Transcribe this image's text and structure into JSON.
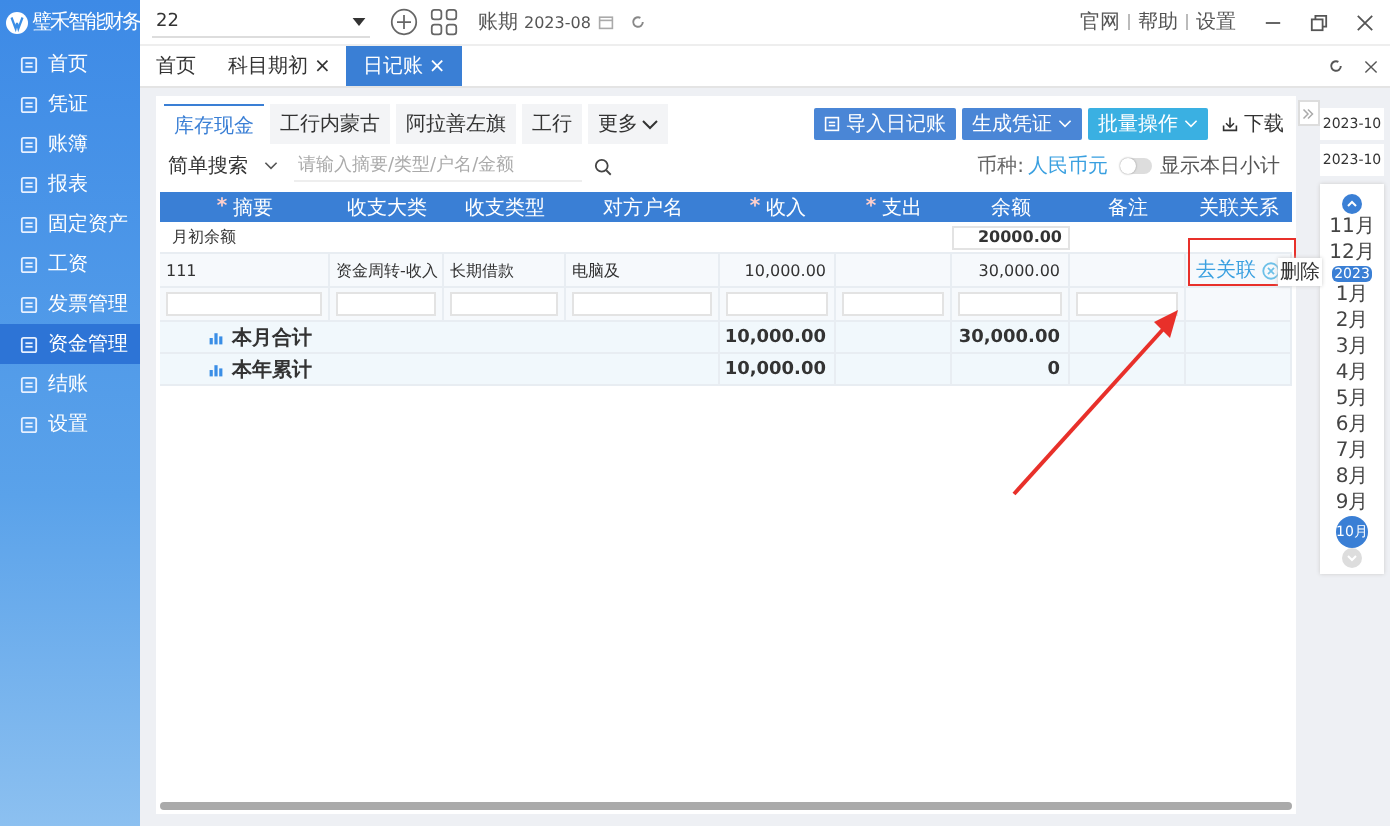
{
  "app": {
    "logo": "璧禾智能财务"
  },
  "sidebar": {
    "items": [
      {
        "label": "首页",
        "selected": false
      },
      {
        "label": "凭证",
        "selected": false
      },
      {
        "label": "账簿",
        "selected": false
      },
      {
        "label": "报表",
        "selected": false
      },
      {
        "label": "固定资产",
        "selected": false
      },
      {
        "label": "工资",
        "selected": false
      },
      {
        "label": "发票管理",
        "selected": false
      },
      {
        "label": "资金管理",
        "selected": true
      },
      {
        "label": "结账",
        "selected": false
      },
      {
        "label": "设置",
        "selected": false
      }
    ]
  },
  "top_bar": {
    "account": "22",
    "period_label": "账期",
    "period": "2023-08",
    "links": [
      "官网",
      "帮助",
      "设置"
    ]
  },
  "tabs": [
    {
      "label": "首页",
      "selected": false
    },
    {
      "label": "科目期初",
      "close_label": "×",
      "selected": false
    },
    {
      "label": "日记账",
      "close_label": "×",
      "selected": true
    }
  ],
  "account_tabs": [
    {
      "label": "库存现金",
      "kind": "tab",
      "selected": true
    },
    {
      "label": "工行内蒙古",
      "kind": "tab",
      "selected": false
    },
    {
      "label": "阿拉善左旗",
      "kind": "tab",
      "selected": false
    },
    {
      "label": "工行",
      "kind": "tab",
      "selected": false
    },
    {
      "label": "更多",
      "kind": "menu",
      "selected": false
    }
  ],
  "actions": [
    {
      "label": "导入日记账",
      "kind": "import",
      "color": "#4a86d6"
    },
    {
      "label": "生成凭证",
      "kind": "dropdown",
      "color": "#4a86d6"
    },
    {
      "label": "批量操作",
      "kind": "dropdown",
      "color": "#3ab0e2"
    },
    {
      "label": "下载",
      "kind": "download"
    }
  ],
  "search": {
    "mode": "简单搜索",
    "placeholder": "请输入摘要/类型/户名/金额"
  },
  "currency": {
    "label": "币种:",
    "value": "人民币元"
  },
  "subtotal_toggle": {
    "label": "显示本日小计",
    "on": false
  },
  "table": {
    "columns": [
      {
        "label": "摘要",
        "required_mark": "*"
      },
      {
        "label": "收支大类"
      },
      {
        "label": "收支类型"
      },
      {
        "label": "对方户名"
      },
      {
        "label": "收入",
        "required_mark": "*"
      },
      {
        "label": "支出",
        "required_mark": "*"
      },
      {
        "label": "余额"
      },
      {
        "label": "备注"
      },
      {
        "label": "关联关系"
      }
    ],
    "opening_row": {
      "label": "月初余额",
      "balance": "20000.00"
    },
    "rows": [
      {
        "summary": "111",
        "category": "资金周转-收入",
        "type": "长期借款",
        "counterparty": "电脑及",
        "income": "10,000.00",
        "balance": "30,000.00",
        "link": "去关联",
        "tooltip": "删除"
      }
    ],
    "totals": [
      {
        "label": "本月合计",
        "income": "10,000.00",
        "balance": "30,000.00"
      },
      {
        "label": "本年累计",
        "income": "10,000.00",
        "balance": "0"
      }
    ]
  },
  "month_panel": {
    "range": [
      "2023-10",
      "2023-10"
    ],
    "months": [
      {
        "label": "11月",
        "selected": false
      },
      {
        "label": "12月",
        "selected": false
      },
      {
        "label": "1月",
        "year": "2023",
        "selected": false
      },
      {
        "label": "2月",
        "selected": false
      },
      {
        "label": "3月",
        "selected": false
      },
      {
        "label": "4月",
        "selected": false
      },
      {
        "label": "5月",
        "selected": false
      },
      {
        "label": "6月",
        "selected": false
      },
      {
        "label": "7月",
        "selected": false
      },
      {
        "label": "8月",
        "selected": false
      },
      {
        "label": "9月",
        "selected": false
      },
      {
        "label": "10月",
        "selected": true
      }
    ]
  }
}
